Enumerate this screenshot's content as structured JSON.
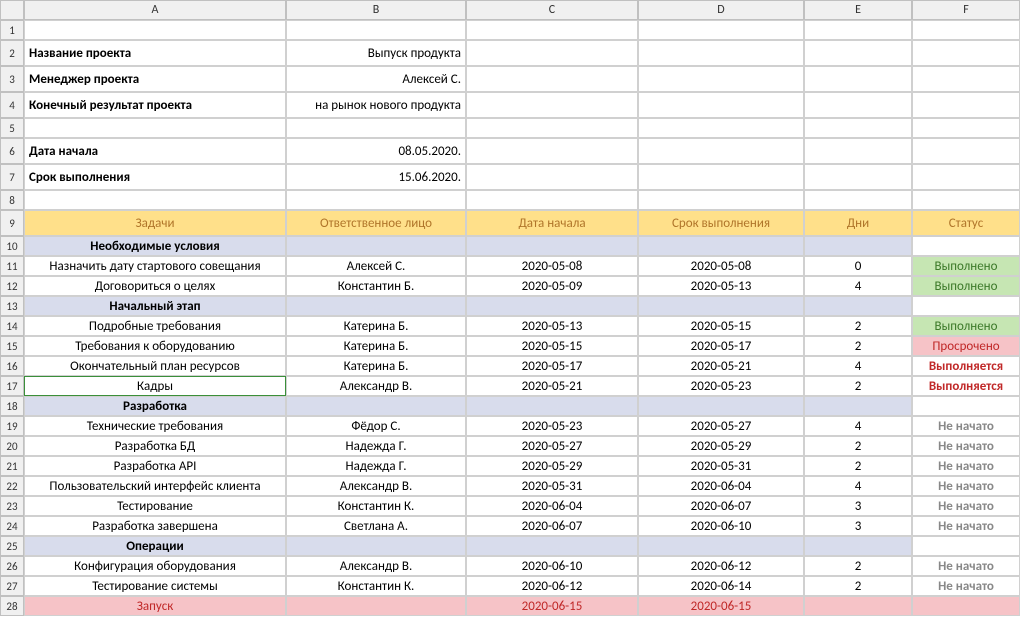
{
  "columns": [
    "",
    "A",
    "B",
    "C",
    "D",
    "E",
    "F"
  ],
  "info": {
    "project_name_label": "Название проекта",
    "project_name_value": "Выпуск продукта",
    "manager_label": "Менеджер проекта",
    "manager_value": "Алексей С.",
    "deliverable_label": "Конечный результат проекта",
    "deliverable_value": "на рынок нового продукта",
    "start_label": "Дата начала",
    "start_value": "08.05.2020.",
    "due_label": "Срок выполнения",
    "due_value": "15.06.2020."
  },
  "headers": {
    "tasks": "Задачи",
    "owner": "Ответственное лицо",
    "start": "Дата начала",
    "due": "Срок выполнения",
    "days": "Дни",
    "status": "Статус"
  },
  "sections": [
    {
      "title": "Необходимые условия",
      "row": 10,
      "tasks": [
        {
          "row": 11,
          "name": "Назначить дату стартового совещания",
          "owner": "Алексей С.",
          "start": "2020-05-08",
          "due": "2020-05-08",
          "days": "0",
          "status": "Выполнено",
          "status_class": "status-done"
        },
        {
          "row": 12,
          "name": "Договориться о целях",
          "owner": "Константин Б.",
          "start": "2020-05-09",
          "due": "2020-05-13",
          "days": "4",
          "status": "Выполнено",
          "status_class": "status-done"
        }
      ]
    },
    {
      "title": "Начальный этап",
      "row": 13,
      "tasks": [
        {
          "row": 14,
          "name": "Подробные требования",
          "owner": "Катерина Б.",
          "start": "2020-05-13",
          "due": "2020-05-15",
          "days": "2",
          "status": "Выполнено",
          "status_class": "status-done"
        },
        {
          "row": 15,
          "name": "Требования к оборудованию",
          "owner": "Катерина Б.",
          "start": "2020-05-15",
          "due": "2020-05-17",
          "days": "2",
          "status": "Просрочено",
          "status_class": "status-late"
        },
        {
          "row": 16,
          "name": "Окончательный план ресурсов",
          "owner": "Катерина Б.",
          "start": "2020-05-17",
          "due": "2020-05-21",
          "days": "4",
          "status": "Выполняется",
          "status_class": "status-prog"
        },
        {
          "row": 17,
          "name": "Кадры",
          "owner": "Александр В.",
          "start": "2020-05-21",
          "due": "2020-05-23",
          "days": "2",
          "status": "Выполняется",
          "status_class": "status-prog",
          "selected": true
        }
      ]
    },
    {
      "title": "Разработка",
      "row": 18,
      "tasks": [
        {
          "row": 19,
          "name": "Технические требования",
          "owner": "Фёдор С.",
          "start": "2020-05-23",
          "due": "2020-05-27",
          "days": "4",
          "status": "Не начато",
          "status_class": "status-notstart"
        },
        {
          "row": 20,
          "name": "Разработка БД",
          "owner": "Надежда Г.",
          "start": "2020-05-27",
          "due": "2020-05-29",
          "days": "2",
          "status": "Не начато",
          "status_class": "status-notstart"
        },
        {
          "row": 21,
          "name": "Разработка API",
          "owner": "Надежда Г.",
          "start": "2020-05-29",
          "due": "2020-05-31",
          "days": "2",
          "status": "Не начато",
          "status_class": "status-notstart"
        },
        {
          "row": 22,
          "name": "Пользовательский интерфейс клиента",
          "owner": "Александр В.",
          "start": "2020-05-31",
          "due": "2020-06-04",
          "days": "4",
          "status": "Не начато",
          "status_class": "status-notstart"
        },
        {
          "row": 23,
          "name": "Тестирование",
          "owner": "Константин К.",
          "start": "2020-06-04",
          "due": "2020-06-07",
          "days": "3",
          "status": "Не начато",
          "status_class": "status-notstart"
        },
        {
          "row": 24,
          "name": "Разработка завершена",
          "owner": "Светлана А.",
          "start": "2020-06-07",
          "due": "2020-06-10",
          "days": "3",
          "status": "Не начато",
          "status_class": "status-notstart"
        }
      ]
    },
    {
      "title": "Операции",
      "row": 25,
      "tasks": [
        {
          "row": 26,
          "name": "Конфигурация оборудования",
          "owner": "Александр В.",
          "start": "2020-06-10",
          "due": "2020-06-12",
          "days": "2",
          "status": "Не начато",
          "status_class": "status-notstart"
        },
        {
          "row": 27,
          "name": "Тестирование системы",
          "owner": "Константин К.",
          "start": "2020-06-12",
          "due": "2020-06-14",
          "days": "2",
          "status": "Не начато",
          "status_class": "status-notstart"
        }
      ]
    }
  ],
  "launch": {
    "row": 28,
    "name": "Запуск",
    "owner": "",
    "start": "2020-06-15",
    "due": "2020-06-15",
    "days": "",
    "status": ""
  }
}
